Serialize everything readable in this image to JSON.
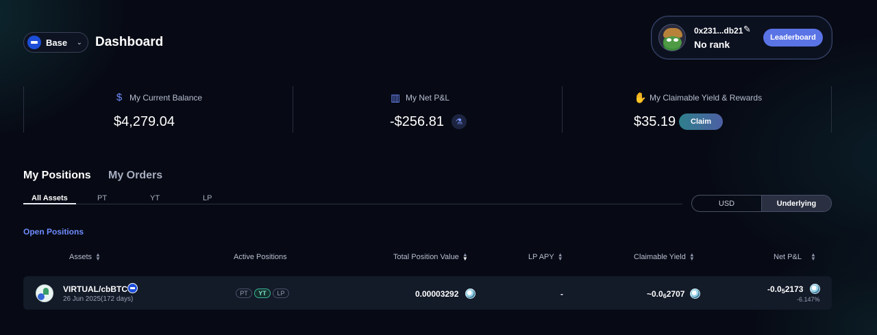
{
  "header": {
    "network": "Base",
    "title": "Dashboard"
  },
  "profile": {
    "address": "0x231...db21",
    "rank": "No rank",
    "leaderboard_label": "Leaderboard"
  },
  "stats": {
    "balance": {
      "label": "My Current Balance",
      "value": "$4,279.04"
    },
    "pnl": {
      "label": "My Net P&L",
      "value": "-$256.81"
    },
    "yield": {
      "label": "My Claimable Yield & Rewards",
      "value": "$35.19",
      "claim_label": "Claim"
    }
  },
  "tabs": {
    "main": [
      "My Positions",
      "My Orders"
    ],
    "sub": [
      "All Assets",
      "PT",
      "YT",
      "LP"
    ],
    "active_main": "My Positions",
    "active_sub": "All Assets"
  },
  "toggle": {
    "options": [
      "USD",
      "Underlying"
    ],
    "selected": "Underlying"
  },
  "section_title": "Open Positions",
  "table": {
    "headers": [
      "Assets",
      "Active Positions",
      "Total Position Value",
      "LP APY",
      "Claimable Yield",
      "Net P&L"
    ],
    "rows": [
      {
        "asset": "VIRTUAL/cbBTC",
        "maturity": "26 Jun 2025(172 days)",
        "positions": [
          "PT",
          "YT",
          "LP"
        ],
        "active_position": "YT",
        "total_value": "0.00003292",
        "lp_apy": "-",
        "claimable_prefix": "~0.0",
        "claimable_sub": "6",
        "claimable_rest": "2707",
        "pnl_prefix": "-0.0",
        "pnl_sub": "5",
        "pnl_rest": "2173",
        "pnl_pct": "-6.147%"
      }
    ]
  },
  "colors": {
    "accent": "#6f8cff",
    "leaderboard_bg": "#5a74e6",
    "background": "#070a14",
    "active_pill": "#3ab49a"
  },
  "icons": {
    "balance": "dollar-icon",
    "pnl": "bar-chart-icon",
    "yield": "hand-icon",
    "edit": "pencil-icon",
    "flask": "flask-icon"
  }
}
